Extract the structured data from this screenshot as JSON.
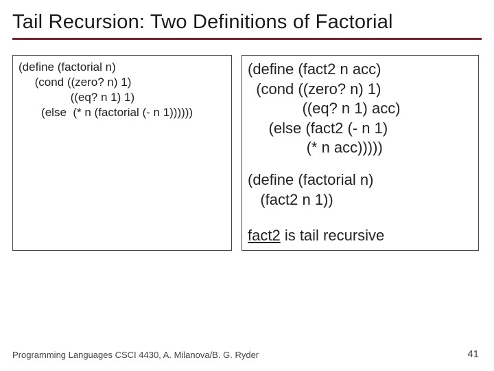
{
  "title": "Tail Recursion: Two Definitions of Factorial",
  "left": {
    "code": "(define (factorial n)\n     (cond ((zero? n) 1)\n                ((eq? n 1) 1)\n       (else  (* n (factorial (- n 1))))))"
  },
  "right": {
    "code1": "(define (fact2 n acc)\n  (cond ((zero? n) 1)\n             ((eq? n 1) acc)\n     (else (fact2 (- n 1)\n              (* n acc)))))",
    "code2": "(define (factorial n)\n   (fact2 n 1))",
    "note_uword": "fact2",
    "note_rest": " is tail recursive"
  },
  "footer": {
    "left": "Programming Languages CSCI 4430, A. Milanova/B. G. Ryder",
    "page": "41"
  }
}
